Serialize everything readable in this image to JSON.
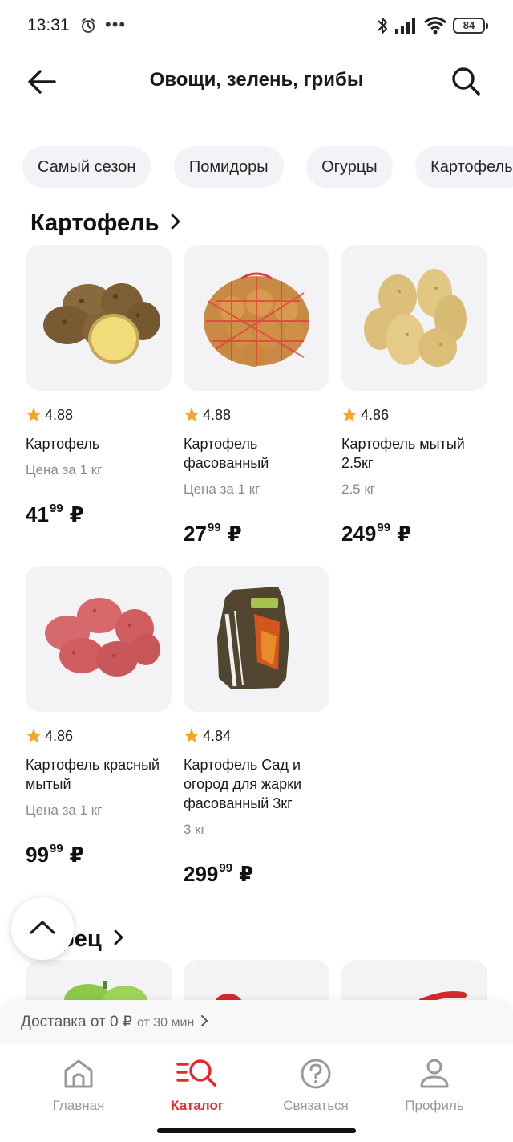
{
  "status_bar": {
    "time": "13:31",
    "battery": "84"
  },
  "header": {
    "title": "Овощи, зелень, грибы"
  },
  "chips": [
    "Самый сезон",
    "Помидоры",
    "Огурцы",
    "Картофель"
  ],
  "sections": [
    {
      "title": "Картофель",
      "products": [
        {
          "rating": "4.88",
          "name": "Картофель",
          "unit": "Цена за 1 кг",
          "price_int": "41",
          "price_dec": "99",
          "currency": "₽"
        },
        {
          "rating": "4.88",
          "name": "Картофель фасованный",
          "unit": "Цена за 1 кг",
          "price_int": "27",
          "price_dec": "99",
          "currency": "₽"
        },
        {
          "rating": "4.86",
          "name": "Картофель мытый 2.5кг",
          "unit": "2.5 кг",
          "price_int": "249",
          "price_dec": "99",
          "currency": "₽"
        },
        {
          "rating": "4.86",
          "name": "Картофель красный мытый",
          "unit": "Цена за 1 кг",
          "price_int": "99",
          "price_dec": "99",
          "currency": "₽"
        },
        {
          "rating": "4.84",
          "name": "Картофель Сад и огород для жарки фасованный 3кг",
          "unit": "3 кг",
          "price_int": "299",
          "price_dec": "99",
          "currency": "₽"
        }
      ]
    },
    {
      "title": "Перец"
    }
  ],
  "delivery": {
    "main": "Доставка от 0 ₽",
    "sub": "от 30 мин"
  },
  "nav": [
    {
      "label": "Главная",
      "icon": "home-icon"
    },
    {
      "label": "Каталог",
      "icon": "catalog-search-icon"
    },
    {
      "label": "Связаться",
      "icon": "help-icon"
    },
    {
      "label": "Профиль",
      "icon": "profile-icon"
    }
  ],
  "colors": {
    "accent": "#e5282c",
    "star": "#f5a623",
    "chip_bg": "#f3f2f6",
    "card_bg": "#f3f2f5"
  }
}
